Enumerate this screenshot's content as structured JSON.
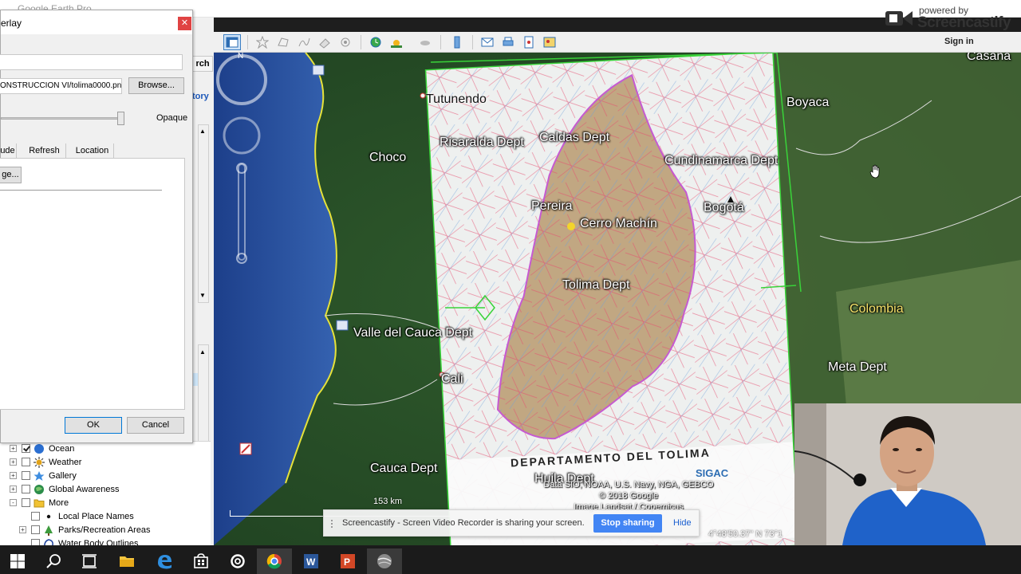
{
  "window": {
    "title": "Google Earth Pro"
  },
  "branding": {
    "powered_by": "powered by",
    "name": "Screencastify"
  },
  "account": {
    "sign_in": "Sign in"
  },
  "search_panel": {
    "search_button": "rch",
    "history_tab": "tory"
  },
  "dialog": {
    "title": "erlay",
    "link_value": "ONSTRUCCION VI/tolima0000.png",
    "browse_label": "Browse...",
    "opacity_label": "Opaque",
    "opacity_value": 1.0,
    "tabs": [
      "ude",
      "Refresh",
      "Location"
    ],
    "pane_button": "ge...",
    "ok_label": "OK",
    "cancel_label": "Cancel"
  },
  "tree": [
    {
      "label": "Ocean",
      "checked": true,
      "expander": "+",
      "icon": "globe-icon"
    },
    {
      "label": "Weather",
      "checked": false,
      "expander": "+",
      "icon": "sun-icon"
    },
    {
      "label": "Gallery",
      "checked": false,
      "expander": "+",
      "icon": "star-icon"
    },
    {
      "label": "Global Awareness",
      "checked": false,
      "expander": "+",
      "icon": "globe-icon"
    },
    {
      "label": "More",
      "checked": false,
      "expander": "-",
      "icon": "folder-icon"
    },
    {
      "label": "Local Place Names",
      "checked": false,
      "expander": "",
      "icon": "dot-icon"
    },
    {
      "label": "Parks/Recreation Areas",
      "checked": false,
      "expander": "+",
      "icon": "tree-icon"
    },
    {
      "label": "Water Body Outlines",
      "checked": false,
      "expander": "",
      "icon": "outline-icon"
    }
  ],
  "map": {
    "labels": {
      "tutunendo": "Tutunendo",
      "risaralda": "Risaralda Dept",
      "caldas": "Caldas Dept",
      "choco": "Choco",
      "boyaca": "Boyaca",
      "cundinamarca": "Cundinamarca Dept",
      "pereira": "Pereira",
      "cerro_machin": "Cerro Machín",
      "bogota": "Bogotá",
      "tolima": "Tolima Dept",
      "colombia": "Colombia",
      "valle": "Valle del Cauca Dept",
      "cali": "Cali",
      "meta": "Meta Dept",
      "cauca": "Cauca Dept",
      "huila": "Huila Dept",
      "casanare": "Casana"
    },
    "overlay_title": "DEPARTAMENTO DEL TOLIMA",
    "overlay_logo": "SIGAC",
    "copyright": [
      "Data SIO, NOAA, U.S. Navy, NGA, GEBCO",
      "© 2018 Google",
      "Image Landsat / Copernicus"
    ],
    "scale": "153 km",
    "coordinates": "4°48'50.37\" N   73°1"
  },
  "sharebar": {
    "message": "Screencastify - Screen Video Recorder is sharing your screen.",
    "stop_label": "Stop sharing",
    "hide_label": "Hide"
  },
  "colors": {
    "accent": "#4285f4",
    "boundary": "#dcdcdc",
    "overlay_border": "#39d339",
    "coast": "#e6e23a"
  },
  "taskbar": [
    "windows-start-icon",
    "search-icon",
    "task-view-icon",
    "file-explorer-icon",
    "edge-icon",
    "store-icon",
    "settings-icon",
    "chrome-icon",
    "word-icon",
    "powerpoint-icon",
    "google-earth-icon"
  ]
}
